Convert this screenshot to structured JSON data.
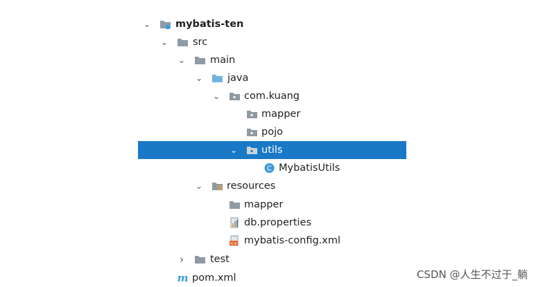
{
  "tree": {
    "project": {
      "label": "mybatis-ten",
      "expanded": true
    },
    "src": {
      "label": "src",
      "expanded": true
    },
    "main": {
      "label": "main",
      "expanded": true
    },
    "java": {
      "label": "java",
      "expanded": true
    },
    "com_kuang": {
      "label": "com.kuang",
      "expanded": true
    },
    "mapper_pkg": {
      "label": "mapper"
    },
    "pojo_pkg": {
      "label": "pojo"
    },
    "utils_pkg": {
      "label": "utils",
      "expanded": true,
      "selected": true
    },
    "mybatis_utils": {
      "label": "MybatisUtils",
      "icon": "class-icon"
    },
    "resources": {
      "label": "resources",
      "expanded": true
    },
    "res_mapper": {
      "label": "mapper"
    },
    "db_properties": {
      "label": "db.properties",
      "icon": "properties-file-icon"
    },
    "mybatis_config": {
      "label": "mybatis-config.xml",
      "icon": "xml-file-icon"
    },
    "test": {
      "label": "test",
      "expanded": false
    },
    "pom": {
      "label": "pom.xml",
      "icon": "maven-icon"
    }
  },
  "watermark": "CSDN @人生不过于_躺",
  "colors": {
    "selection": "#1a79c6",
    "folder_gray": "#8f9aa3",
    "source_folder": "#6fb3e0",
    "class_icon": "#3d9ad9"
  }
}
